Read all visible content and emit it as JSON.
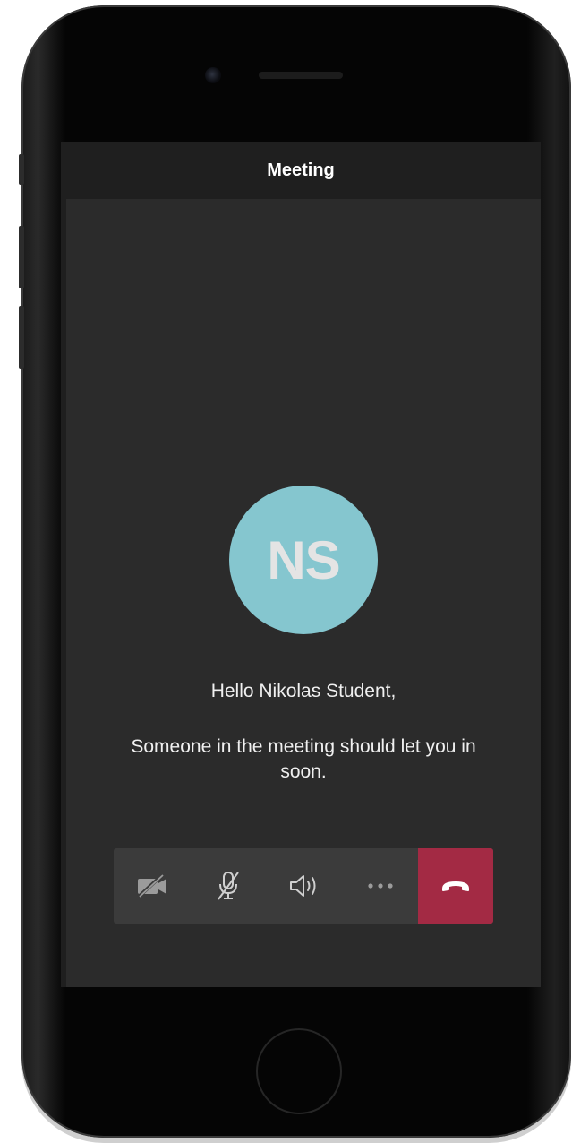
{
  "header": {
    "title": "Meeting"
  },
  "avatar": {
    "initials": "NS",
    "color": "#85c6cf"
  },
  "lobby": {
    "greeting": "Hello Nikolas Student,",
    "message": "Someone in the meeting should let you in soon."
  },
  "controls": {
    "items": [
      {
        "icon": "video-off-icon",
        "state": "off"
      },
      {
        "icon": "mic-off-icon",
        "state": "muted"
      },
      {
        "icon": "speaker-icon",
        "state": "on"
      },
      {
        "icon": "more-options-icon"
      },
      {
        "icon": "hang-up-icon"
      }
    ],
    "hang_up_color": "#a32a44"
  },
  "theme": {
    "screen_background": "#2b2b2b",
    "header_background": "#1f1f1f",
    "toolbar_background": "#3b3b3b"
  }
}
